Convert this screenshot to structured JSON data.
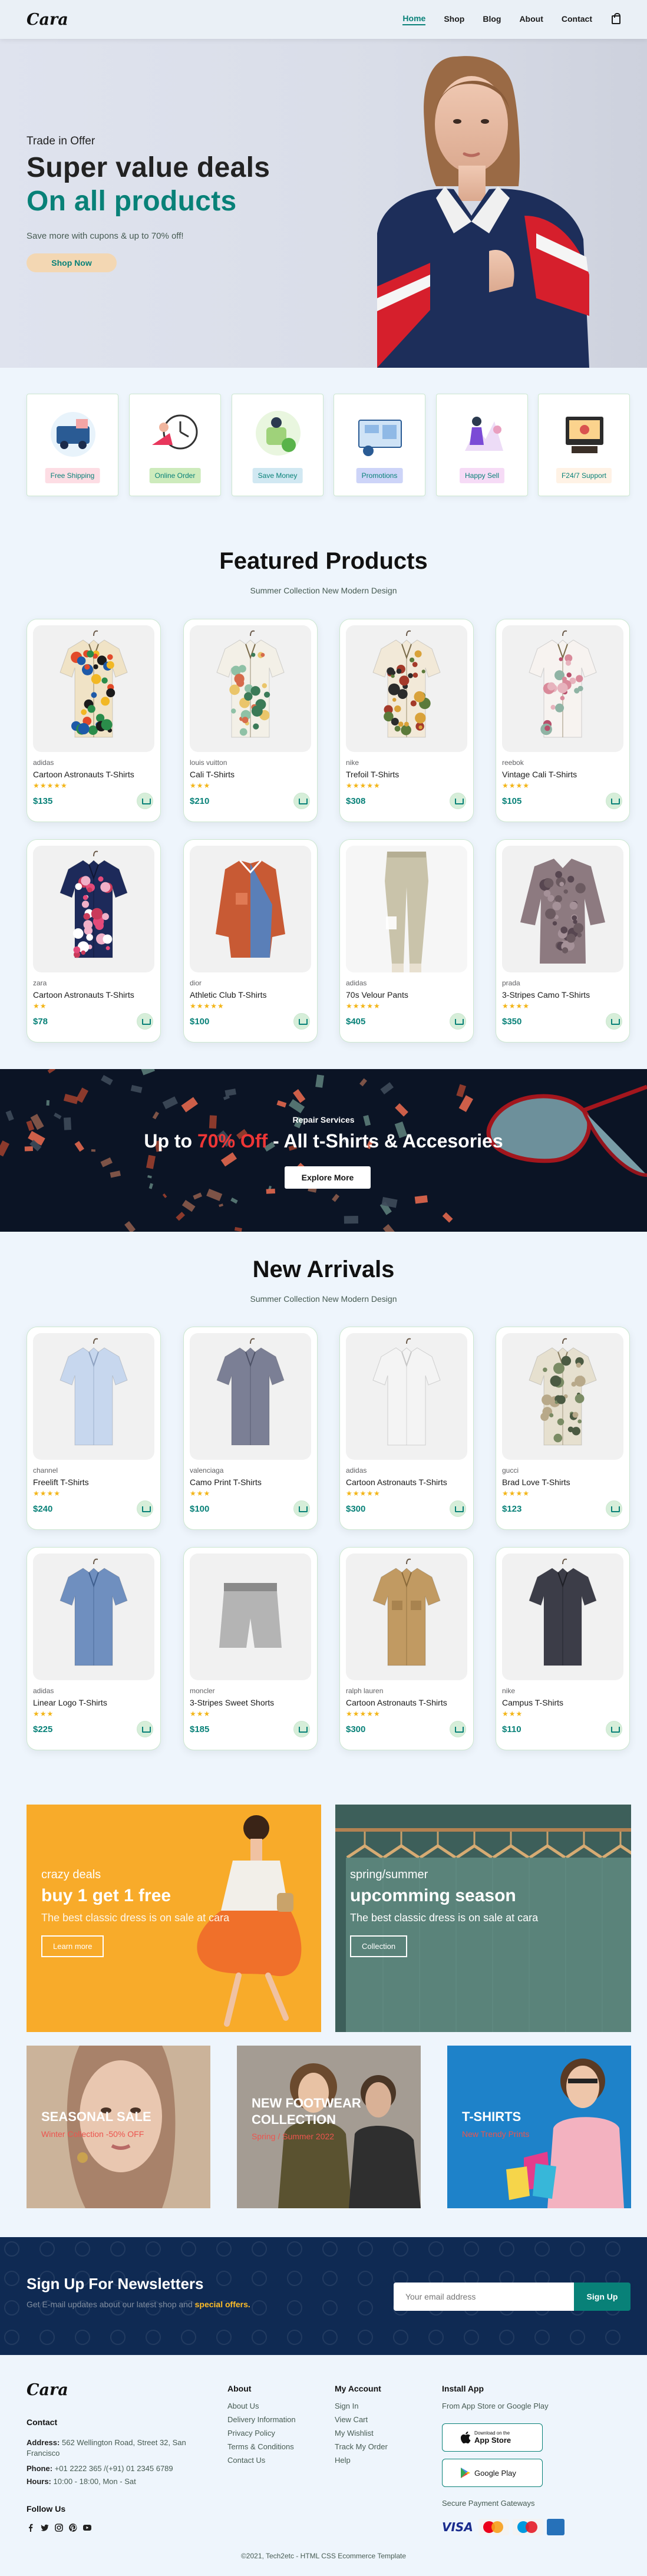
{
  "header": {
    "logo": "Cara",
    "nav": [
      "Home",
      "Shop",
      "Blog",
      "About",
      "Contact"
    ],
    "active": "Home"
  },
  "hero": {
    "kicker": "Trade in Offer",
    "title": "Super value deals",
    "highlight": "On all products",
    "subtitle": "Save more with cupons & up to 70% off!",
    "button": "Shop Now"
  },
  "features": [
    {
      "label": "Free Shipping",
      "bg": "#fddde4"
    },
    {
      "label": "Online Order",
      "bg": "#cdebbc"
    },
    {
      "label": "Save Money",
      "bg": "#d1e8f2"
    },
    {
      "label": "Promotions",
      "bg": "#cdd4f8"
    },
    {
      "label": "Happy Sell",
      "bg": "#f6dbf6"
    },
    {
      "label": "F24/7 Support",
      "bg": "#fff2e5"
    }
  ],
  "featured": {
    "title": "Featured Products",
    "subtitle": "Summer Collection New Modern Design",
    "products": [
      {
        "brand": "adidas",
        "name": "Cartoon Astronauts T-Shirts",
        "stars": 5,
        "price": "$135",
        "art": "hawaii1"
      },
      {
        "brand": "louis vuitton",
        "name": "Cali T-Shirts",
        "stars": 3,
        "price": "$210",
        "art": "hawaii2"
      },
      {
        "brand": "nike",
        "name": "Trefoil T-Shirts",
        "stars": 5,
        "price": "$308",
        "art": "hawaii3"
      },
      {
        "brand": "reebok",
        "name": "Vintage Cali T-Shirts",
        "stars": 4,
        "price": "$105",
        "art": "hawaii4"
      },
      {
        "brand": "zara",
        "name": "Cartoon Astronauts T-Shirts",
        "stars": 2,
        "price": "$78",
        "art": "hawaii5"
      },
      {
        "brand": "dior",
        "name": "Athletic Club T-Shirts",
        "stars": 5,
        "price": "$100",
        "art": "jacket"
      },
      {
        "brand": "adidas",
        "name": "70s Velour Pants",
        "stars": 5,
        "price": "$405",
        "art": "pants"
      },
      {
        "brand": "prada",
        "name": "3-Stripes Camo T-Shirts",
        "stars": 4,
        "price": "$350",
        "art": "blouse"
      }
    ]
  },
  "banner": {
    "kicker": "Repair Services",
    "text_pre": "Up to ",
    "text_hl": "70% Off",
    "text_post": " - All t-Shirts & Accesories",
    "button": "Explore More"
  },
  "arrivals": {
    "title": "New Arrivals",
    "subtitle": "Summer Collection New Modern Design",
    "products": [
      {
        "brand": "channel",
        "name": "Freelift T-Shirts",
        "stars": 4,
        "price": "$240",
        "art": "shirt-lightblue"
      },
      {
        "brand": "valenciaga",
        "name": "Camo Print T-Shirts",
        "stars": 3,
        "price": "$100",
        "art": "shirt-grey"
      },
      {
        "brand": "adidas",
        "name": "Cartoon Astronauts T-Shirts",
        "stars": 5,
        "price": "$300",
        "art": "shirt-white"
      },
      {
        "brand": "gucci",
        "name": "Brad Love T-Shirts",
        "stars": 4,
        "price": "$123",
        "art": "shirt-floral"
      },
      {
        "brand": "adidas",
        "name": "Linear Logo T-Shirts",
        "stars": 3,
        "price": "$225",
        "art": "shirt-denim"
      },
      {
        "brand": "moncler",
        "name": "3-Stripes Sweet Shorts",
        "stars": 3,
        "price": "$185",
        "art": "shorts"
      },
      {
        "brand": "ralph lauren",
        "name": "Cartoon Astronauts T-Shirts",
        "stars": 5,
        "price": "$300",
        "art": "shirt-khaki"
      },
      {
        "brand": "nike",
        "name": "Campus T-Shirts",
        "stars": 3,
        "price": "$110",
        "art": "shirt-dark"
      }
    ]
  },
  "promos": {
    "left": {
      "kicker": "crazy deals",
      "title": "buy 1 get 1 free",
      "sub": "The best classic dress is on sale at cara",
      "button": "Learn more"
    },
    "right": {
      "kicker": "spring/summer",
      "title": "upcomming season",
      "sub": "The best classic dress is on sale at cara",
      "button": "Collection"
    }
  },
  "promos_small": [
    {
      "title": "SEASONAL SALE",
      "sub": "Winter Collection -50% OFF"
    },
    {
      "title": "NEW FOOTWEAR COLLECTION",
      "sub": "Spring / Summer 2022"
    },
    {
      "title": "T-SHIRTS",
      "sub": "New Trendy Prints"
    }
  ],
  "newsletter": {
    "title": "Sign Up For Newsletters",
    "text_pre": "Get E-mail updates about our latest shop and ",
    "text_hl": "special offers.",
    "placeholder": "Your email address",
    "button": "Sign Up"
  },
  "footer": {
    "logo": "Cara",
    "contact_h": "Contact",
    "address_l": "Address:",
    "address": "562 Wellington Road, Street 32, San Francisco",
    "phone_l": "Phone:",
    "phone": "+01 2222 365 /(+91) 01 2345 6789",
    "hours_l": "Hours:",
    "hours": "10:00 - 18:00, Mon - Sat",
    "follow": "Follow Us",
    "about_h": "About",
    "about_links": [
      "About Us",
      "Delivery Information",
      "Privacy Policy",
      "Terms & Conditions",
      "Contact Us"
    ],
    "account_h": "My Account",
    "account_links": [
      "Sign In",
      "View Cart",
      "My Wishlist",
      "Track My Order",
      "Help"
    ],
    "install_h": "Install App",
    "install_p": "From App Store or Google Play",
    "appstore": "App Store",
    "appstore_small": "Download on the",
    "googleplay": "Google Play",
    "gateways": "Secure Payment Gateways",
    "copyright": "©2021, Tech2etc - HTML CSS Ecommerce Template"
  }
}
